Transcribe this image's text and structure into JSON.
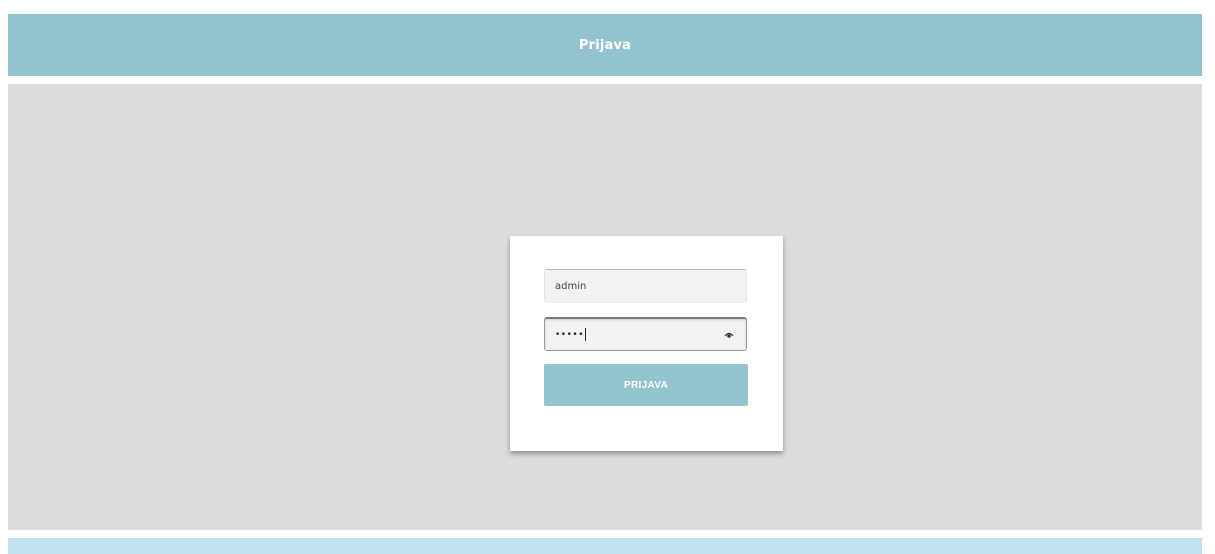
{
  "header": {
    "title": "Prijava"
  },
  "login_form": {
    "username": {
      "value": "admin"
    },
    "password": {
      "masked_value": "•••••",
      "icon": "eye-icon"
    },
    "submit_label": "PRIJAVA"
  },
  "colors": {
    "header_bg": "#93c3ce",
    "main_bg": "#dcdcdc",
    "footer_bg": "#c2e0ed",
    "button_bg": "#93c3ce"
  }
}
